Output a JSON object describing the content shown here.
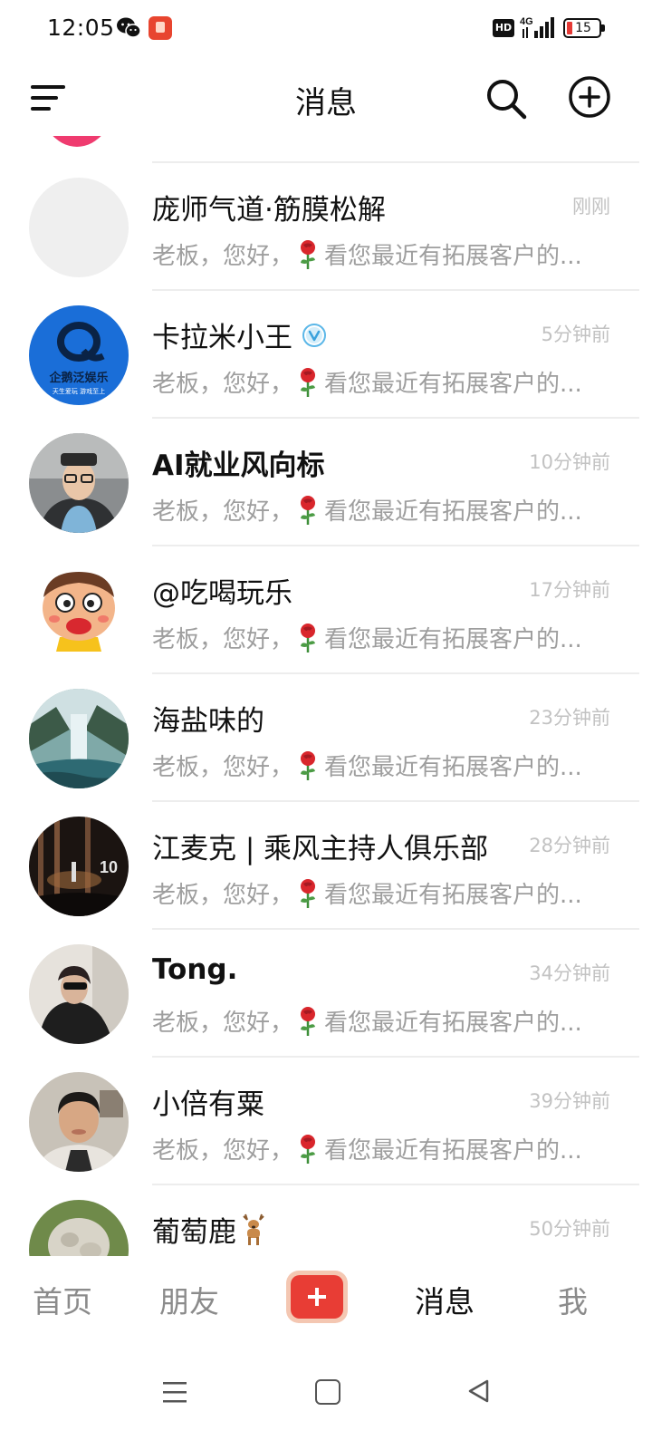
{
  "status_bar": {
    "time": "12:05",
    "network": "4G",
    "hd_label": "HD",
    "battery_level": "15"
  },
  "header": {
    "title": "消息"
  },
  "messages": [
    {
      "name": "庞师气道·筋膜松解",
      "time": "刚刚",
      "preview_before": "老板，您好，",
      "preview_after": "看您最近有拓展客户的...",
      "avatar": "blank-avatar"
    },
    {
      "name": "卡拉米小王",
      "verified": true,
      "time": "5分钟前",
      "preview_before": "老板，您好，",
      "preview_after": "看您最近有拓展客户的...",
      "avatar": "logo-avatar",
      "avatar_text": "企鹅泛娱乐",
      "avatar_subtext": "天生爱玩  游戏至上"
    },
    {
      "name": "AI就业风向标",
      "time": "10分钟前",
      "preview_before": "老板，您好，",
      "preview_after": "看您最近有拓展客户的...",
      "avatar": "man-glasses-avatar"
    },
    {
      "name": "@吃喝玩乐",
      "time": "17分钟前",
      "preview_before": "老板，您好，",
      "preview_after": "看您最近有拓展客户的...",
      "avatar": "cartoon-boy-avatar"
    },
    {
      "name": "海盐味的",
      "time": "23分钟前",
      "preview_before": "老板，您好，",
      "preview_after": "看您最近有拓展客户的...",
      "avatar": "waterfall-avatar"
    },
    {
      "name": "江麦克 | 乘风主持人俱乐部",
      "time": "28分钟前",
      "preview_before": "老板，您好，",
      "preview_after": "看您最近有拓展客户的...",
      "avatar": "stage-avatar",
      "avatar_text": "10"
    },
    {
      "name": "Tong.",
      "time": "34分钟前",
      "preview_before": "老板，您好，",
      "preview_after": "看您最近有拓展客户的...",
      "avatar": "woman-sunglasses-avatar"
    },
    {
      "name": "小倍有粟",
      "time": "39分钟前",
      "preview_before": "老板，您好，",
      "preview_after": "看您最近有拓展客户的...",
      "avatar": "young-man-avatar"
    },
    {
      "name": "葡萄鹿",
      "time": "50分钟前",
      "avatar": "fluffy-avatar"
    }
  ],
  "bottom_nav": {
    "home": "首页",
    "friends": "朋友",
    "messages": "消息",
    "me": "我"
  },
  "colors": {
    "accent_red": "#e83d35",
    "time_gray": "#c2c2c2",
    "preview_gray": "#9e9e9e",
    "verified_blue": "#5bb7e8"
  }
}
